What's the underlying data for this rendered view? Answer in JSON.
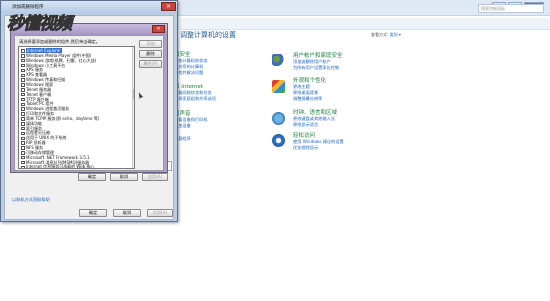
{
  "control_panel": {
    "title": "调整计算机的设置",
    "view_by_label": "查看方式:",
    "view_by_value": "类别",
    "search_placeholder": "搜索控制面板",
    "categories": [
      {
        "title": "用户帐户和家庭安全",
        "links": [
          "添加或删除用户帐户",
          "为所有用户设置家长控制"
        ]
      },
      {
        "title": "外观和个性化",
        "links": [
          "更改主题",
          "更改桌面背景",
          "调整屏幕分辨率"
        ]
      },
      {
        "title": "时钟、语言和区域",
        "links": [
          "更改键盘或其他输入法",
          "更改显示语言"
        ]
      },
      {
        "title": "轻松访问",
        "links": [
          "使用 Windows 建议的设置",
          "优化视频显示"
        ]
      }
    ],
    "left_fragments": {
      "a": {
        "title": "和安全",
        "links": [
          "检查计算机的状态",
          "备份您的计算机",
          "查找并解决问题"
        ]
      },
      "b": {
        "title": "和 Internet",
        "links": [
          "查看网络状态和任务",
          "选择家庭组和共享选项"
        ]
      },
      "c": {
        "title": "和声音",
        "links": [
          "查看设备和打印机",
          "添加设备"
        ]
      },
      "d": {
        "links": [
          "卸载程序"
        ]
      }
    }
  },
  "dialog": {
    "title": "添加或删除程序",
    "logo": "秒懂视频",
    "link": "以联机方式获取帮助",
    "ok": "确定",
    "cancel": "取消",
    "apply": "应用(A)"
  },
  "inner_dialog": {
    "prompt": "请选择要添加或删除的组件,然后单击确定。",
    "buttons": {
      "add": "添加",
      "remove": "删除",
      "properties": "属性(P)"
    },
    "bottom_buttons": {
      "ok": "确定",
      "cancel": "取消",
      "apply": "应用(A)"
    },
    "list_items": [
      "Internet Explorer",
      "Windows Media Player 组件(中国)",
      "Windows 游戏(纸牌、扫雷、红心大战)",
      "Windows 小工具平台",
      "XPS 服务",
      "XPS 查看器",
      "Windows 传真和扫描",
      "Windows 搜索",
      "Telnet 服务器",
      "Telnet 客户端",
      "TFTP 客户端",
      "Tablet PC 组件",
      "Windows 进程激活服务",
      "打印和文件服务",
      "简单 TCPIP 服务(即 echo、daytime 等)",
      "媒体功能",
      "索引服务",
      "远程差分压缩",
      "适用于 UNIX 的子系统",
      "RIP 侦听器",
      "NFS 服务",
      "可移动存储管理",
      "Microsoft .NET Framework 3.5.1",
      "Microsoft 消息队列(MSMQ)服务器",
      "Internet 信息服务可承载的 Web 核心"
    ],
    "selected_index": 0
  }
}
